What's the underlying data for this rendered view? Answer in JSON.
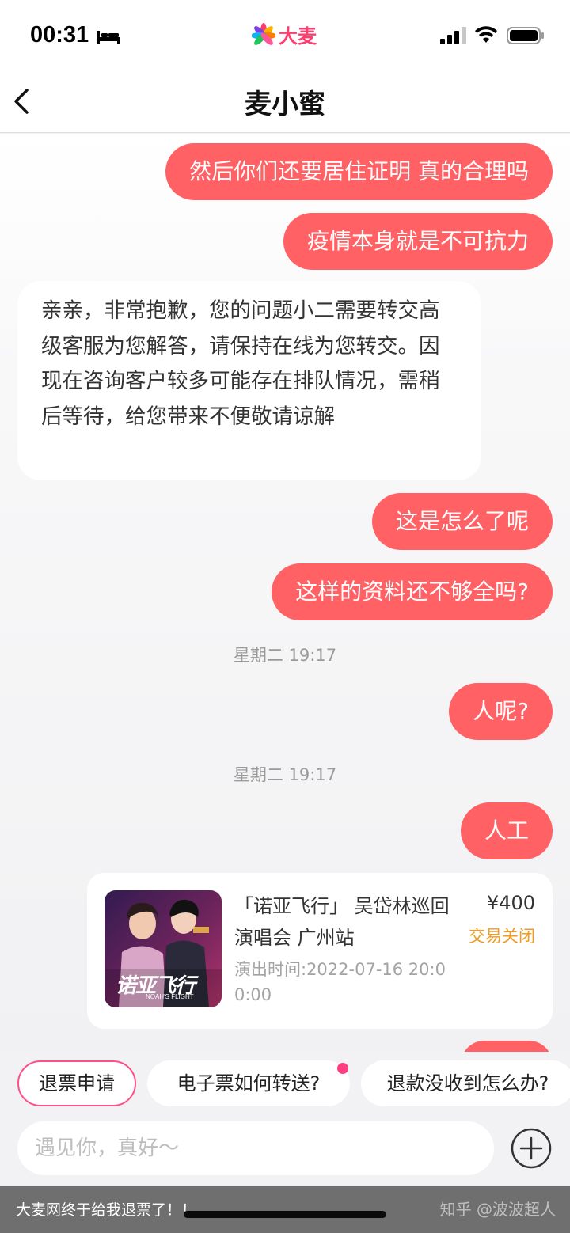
{
  "status_bar": {
    "time": "00:31",
    "brand_name": "大麦",
    "icons": [
      "bed-icon",
      "signal-icon",
      "wifi-icon",
      "battery-icon"
    ]
  },
  "nav": {
    "title": "麦小蜜"
  },
  "messages": [
    {
      "side": "right",
      "text": "然后你们还要居住证明 真的合理吗"
    },
    {
      "side": "right",
      "text": "疫情本身就是不可抗力"
    },
    {
      "side": "left",
      "text": "亲亲，非常抱歉，您的问题小二需要转交高级客服为您解答，请保持在线为您转交。因现在咨询客户较多可能存在排队情况，需稍后等待，给您带来不便敬请谅解"
    },
    {
      "side": "right",
      "text": "这是怎么了呢"
    },
    {
      "side": "right",
      "text": "这样的资料还不够全吗?"
    },
    {
      "side": "time",
      "text": "星期二 19:17"
    },
    {
      "side": "right",
      "text": "人呢?"
    },
    {
      "side": "time",
      "text": "星期二 19:17"
    },
    {
      "side": "right",
      "text": "人工"
    }
  ],
  "order_card": {
    "title": "「诺亚飞行」 吴岱林巡回演唱会 广州站",
    "show_time": "演出时间:2022-07-16 20:00:00",
    "price": "¥400",
    "status": "交易关闭",
    "poster_text": "诺亚飞行",
    "poster_subtext": "NOAH'S FLIGHT"
  },
  "quick_replies": [
    "退票申请",
    "电子票如何转送?",
    "退款没收到怎么办?"
  ],
  "input": {
    "placeholder": "遇见你，真好～"
  },
  "caption": {
    "text": "大麦网终于给我退票了！！",
    "watermark": "知乎 @波波超人"
  },
  "colors": {
    "bubble_user": "#ff6164",
    "bubble_agent": "#ffffff",
    "brand": "#ff3d6f",
    "status_closed": "#f39a1f",
    "chip_border": "#ff4f86"
  }
}
